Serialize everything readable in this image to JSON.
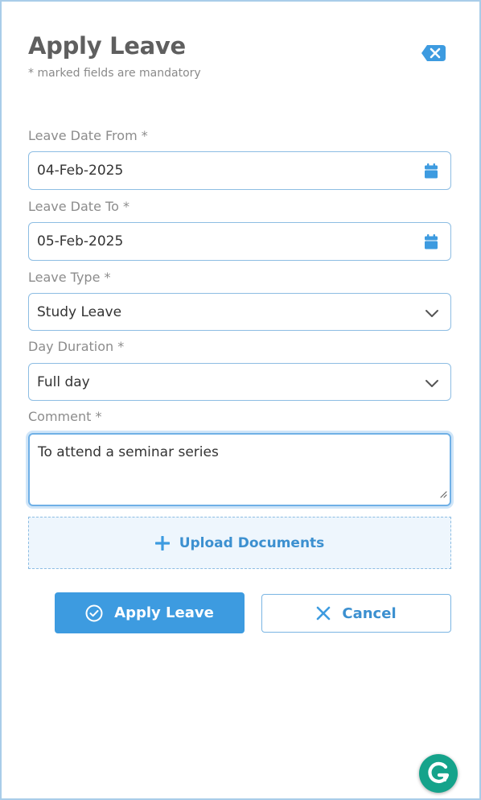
{
  "header": {
    "title": "Apply Leave",
    "subtitle": "* marked fields are mandatory"
  },
  "form": {
    "leave_date_from": {
      "label": "Leave Date From *",
      "value": "04-Feb-2025",
      "icon": "calendar-icon"
    },
    "leave_date_to": {
      "label": "Leave Date To *",
      "value": "05-Feb-2025",
      "icon": "calendar-icon"
    },
    "leave_type": {
      "label": "Leave Type *",
      "value": "Study Leave",
      "icon": "chevron-down-icon"
    },
    "day_duration": {
      "label": "Day Duration *",
      "value": "Full day",
      "icon": "chevron-down-icon"
    },
    "comment": {
      "label": "Comment *",
      "value": "To attend a seminar series"
    }
  },
  "upload": {
    "label": "Upload Documents",
    "icon": "plus-icon"
  },
  "actions": {
    "apply_label": "Apply Leave",
    "apply_icon": "check-circle-icon",
    "cancel_label": "Cancel",
    "cancel_icon": "close-icon"
  },
  "colors": {
    "accent": "#3d9be0",
    "field_border": "#8dbde3",
    "label": "#8c8c8c",
    "grammarly": "#15a38b"
  }
}
